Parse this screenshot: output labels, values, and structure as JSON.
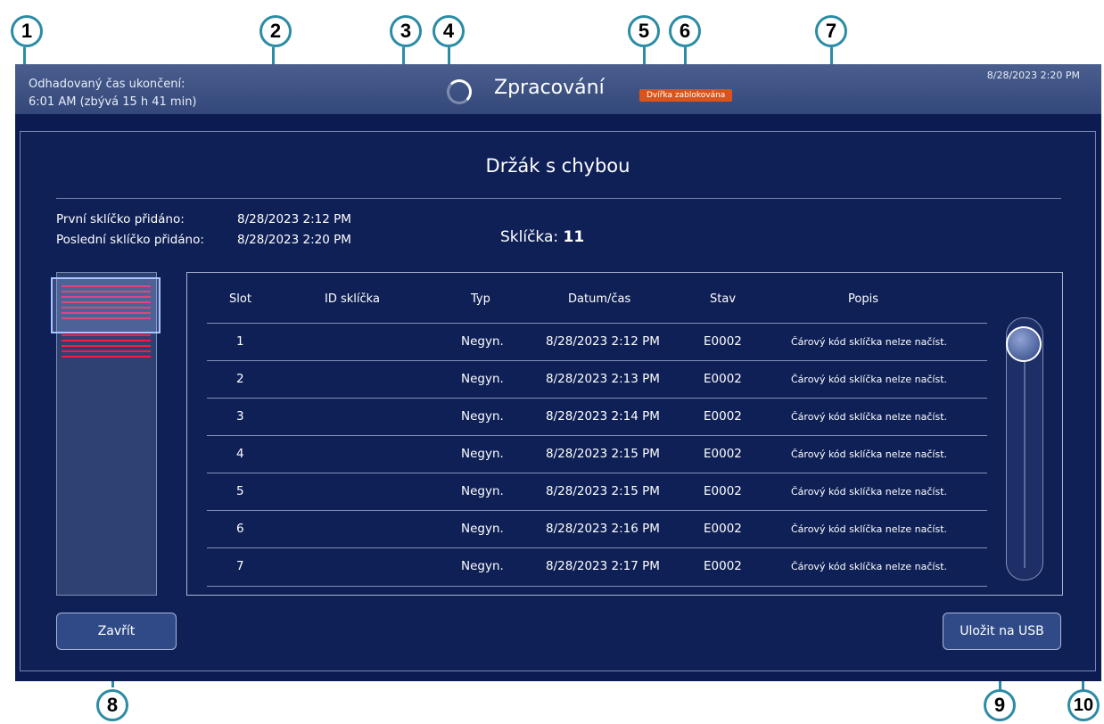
{
  "header": {
    "estimate_line1": "Odhadovaný čas ukončení:",
    "estimate_line2": "6:01 AM (zbývá 15 h 41 min)",
    "title": "Zpracování",
    "door_badge": "Dvířka zablokována",
    "clock": "8/28/2023 2:20 PM"
  },
  "dialog": {
    "title": "Držák s chybou",
    "first_slide_label": "První sklíčko přidáno:",
    "first_slide_value": "8/28/2023 2:12 PM",
    "last_slide_label": "Poslední sklíčko přidáno:",
    "last_slide_value": "8/28/2023 2:20 PM",
    "slides_label": "Sklíčka:",
    "slides_count": "11",
    "close_button": "Zavřít",
    "save_button": "Uložit na USB"
  },
  "table": {
    "headers": {
      "slot": "Slot",
      "slide_id": "ID sklíčka",
      "type": "Typ",
      "datetime": "Datum/čas",
      "status": "Stav",
      "description": "Popis"
    },
    "rows": [
      {
        "slot": "1",
        "slide_id": "",
        "type": "Negyn.",
        "datetime": "8/28/2023 2:12 PM",
        "status": "E0002",
        "description": "Čárový kód sklíčka nelze načíst."
      },
      {
        "slot": "2",
        "slide_id": "",
        "type": "Negyn.",
        "datetime": "8/28/2023 2:13 PM",
        "status": "E0002",
        "description": "Čárový kód sklíčka nelze načíst."
      },
      {
        "slot": "3",
        "slide_id": "",
        "type": "Negyn.",
        "datetime": "8/28/2023 2:14 PM",
        "status": "E0002",
        "description": "Čárový kód sklíčka nelze načíst."
      },
      {
        "slot": "4",
        "slide_id": "",
        "type": "Negyn.",
        "datetime": "8/28/2023 2:15 PM",
        "status": "E0002",
        "description": "Čárový kód sklíčka nelze načíst."
      },
      {
        "slot": "5",
        "slide_id": "",
        "type": "Negyn.",
        "datetime": "8/28/2023 2:15 PM",
        "status": "E0002",
        "description": "Čárový kód sklíčka nelze načíst."
      },
      {
        "slot": "6",
        "slide_id": "",
        "type": "Negyn.",
        "datetime": "8/28/2023 2:16 PM",
        "status": "E0002",
        "description": "Čárový kód sklíčka nelze načíst."
      },
      {
        "slot": "7",
        "slide_id": "",
        "type": "Negyn.",
        "datetime": "8/28/2023 2:17 PM",
        "status": "E0002",
        "description": "Čárový kód sklíčka nelze načíst."
      }
    ]
  },
  "scrollbar": {
    "position_fraction": 0
  },
  "callouts": [
    "1",
    "2",
    "3",
    "4",
    "5",
    "6",
    "7",
    "8",
    "9",
    "10"
  ],
  "colors": {
    "background": "#0c1b52",
    "accent_callout": "#2c8ca5",
    "error_slot": "#ff1a3a",
    "door_badge": "#d9541b"
  }
}
